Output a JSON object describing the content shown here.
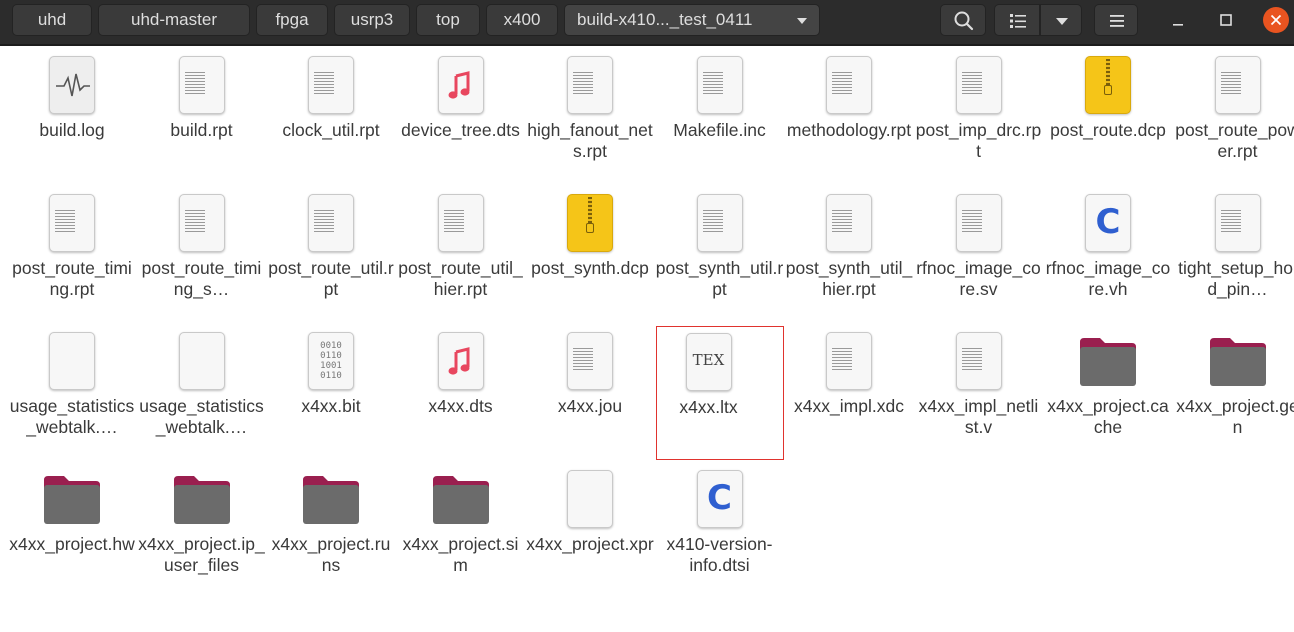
{
  "breadcrumbs": [
    "uhd",
    "uhd-master",
    "fpga",
    "usrp3",
    "top",
    "x400",
    "build-x410..._test_0411"
  ],
  "icons": {
    "search": "search-icon",
    "view": "list-view-icon",
    "sort": "chevron-down-icon",
    "menu": "hamburger-menu-icon",
    "minimize": "minimize-icon",
    "maximize": "maximize-icon",
    "close": "close-icon"
  },
  "colors": {
    "header_bg": "#2c2c2c",
    "close_button": "#e95420",
    "folder": "#6b6b6b",
    "folder_tab": "#9a1f4f",
    "archive": "#f5c518",
    "audio": "#e8475f",
    "c_source": "#2f5fd0",
    "selection_box": "#e0332e"
  },
  "files": [
    {
      "name": "build.log",
      "icon": "log-waveform-icon"
    },
    {
      "name": "build.rpt",
      "icon": "text-file-icon"
    },
    {
      "name": "clock_util.rpt",
      "icon": "text-file-icon"
    },
    {
      "name": "device_tree.dts",
      "icon": "music-note-icon"
    },
    {
      "name": "high_fanout_nets.rpt",
      "icon": "text-file-icon"
    },
    {
      "name": "Makefile.inc",
      "icon": "text-file-icon"
    },
    {
      "name": "methodology.rpt",
      "icon": "text-file-icon"
    },
    {
      "name": "post_imp_drc.rpt",
      "icon": "text-file-icon"
    },
    {
      "name": "post_route.dcp",
      "icon": "zip-archive-icon"
    },
    {
      "name": "post_route_power.rpt",
      "icon": "text-file-icon"
    },
    {
      "name": "post_route_timing.rpt",
      "icon": "text-file-icon"
    },
    {
      "name": "post_route_timing_s…",
      "icon": "text-file-icon"
    },
    {
      "name": "post_route_util.rpt",
      "icon": "text-file-icon"
    },
    {
      "name": "post_route_util_hier.rpt",
      "icon": "text-file-icon"
    },
    {
      "name": "post_synth.dcp",
      "icon": "zip-archive-icon"
    },
    {
      "name": "post_synth_util.rpt",
      "icon": "text-file-icon"
    },
    {
      "name": "post_synth_util_hier.rpt",
      "icon": "text-file-icon"
    },
    {
      "name": "rfnoc_image_core.sv",
      "icon": "text-file-icon"
    },
    {
      "name": "rfnoc_image_core.vh",
      "icon": "c-source-icon"
    },
    {
      "name": "tight_setup_hold_pin…",
      "icon": "text-file-icon"
    },
    {
      "name": "usage_statistics_webtalk.…",
      "icon": "code-blue-icon"
    },
    {
      "name": "usage_statistics_webtalk.…",
      "icon": "code-pink-icon"
    },
    {
      "name": "x4xx.bit",
      "icon": "binary-file-icon"
    },
    {
      "name": "x4xx.dts",
      "icon": "music-note-icon"
    },
    {
      "name": "x4xx.jou",
      "icon": "text-file-icon"
    },
    {
      "name": "x4xx.ltx",
      "icon": "tex-file-icon",
      "selected": true
    },
    {
      "name": "x4xx_impl.xdc",
      "icon": "text-file-icon"
    },
    {
      "name": "x4xx_impl_netlist.v",
      "icon": "text-file-icon"
    },
    {
      "name": "x4xx_project.cache",
      "icon": "folder-icon"
    },
    {
      "name": "x4xx_project.gen",
      "icon": "folder-icon"
    },
    {
      "name": "x4xx_project.hw",
      "icon": "folder-icon"
    },
    {
      "name": "x4xx_project.ip_user_files",
      "icon": "folder-icon"
    },
    {
      "name": "x4xx_project.runs",
      "icon": "folder-icon"
    },
    {
      "name": "x4xx_project.sim",
      "icon": "folder-icon"
    },
    {
      "name": "x4xx_project.xpr",
      "icon": "code-pink-icon"
    },
    {
      "name": "x410-version-info.dtsi",
      "icon": "c-source-icon"
    }
  ],
  "glyphs": {
    "c": "C",
    "tex": "TEX",
    "code": "</>",
    "binary_lines": [
      "0010",
      "0110",
      "1001",
      "0110"
    ]
  }
}
